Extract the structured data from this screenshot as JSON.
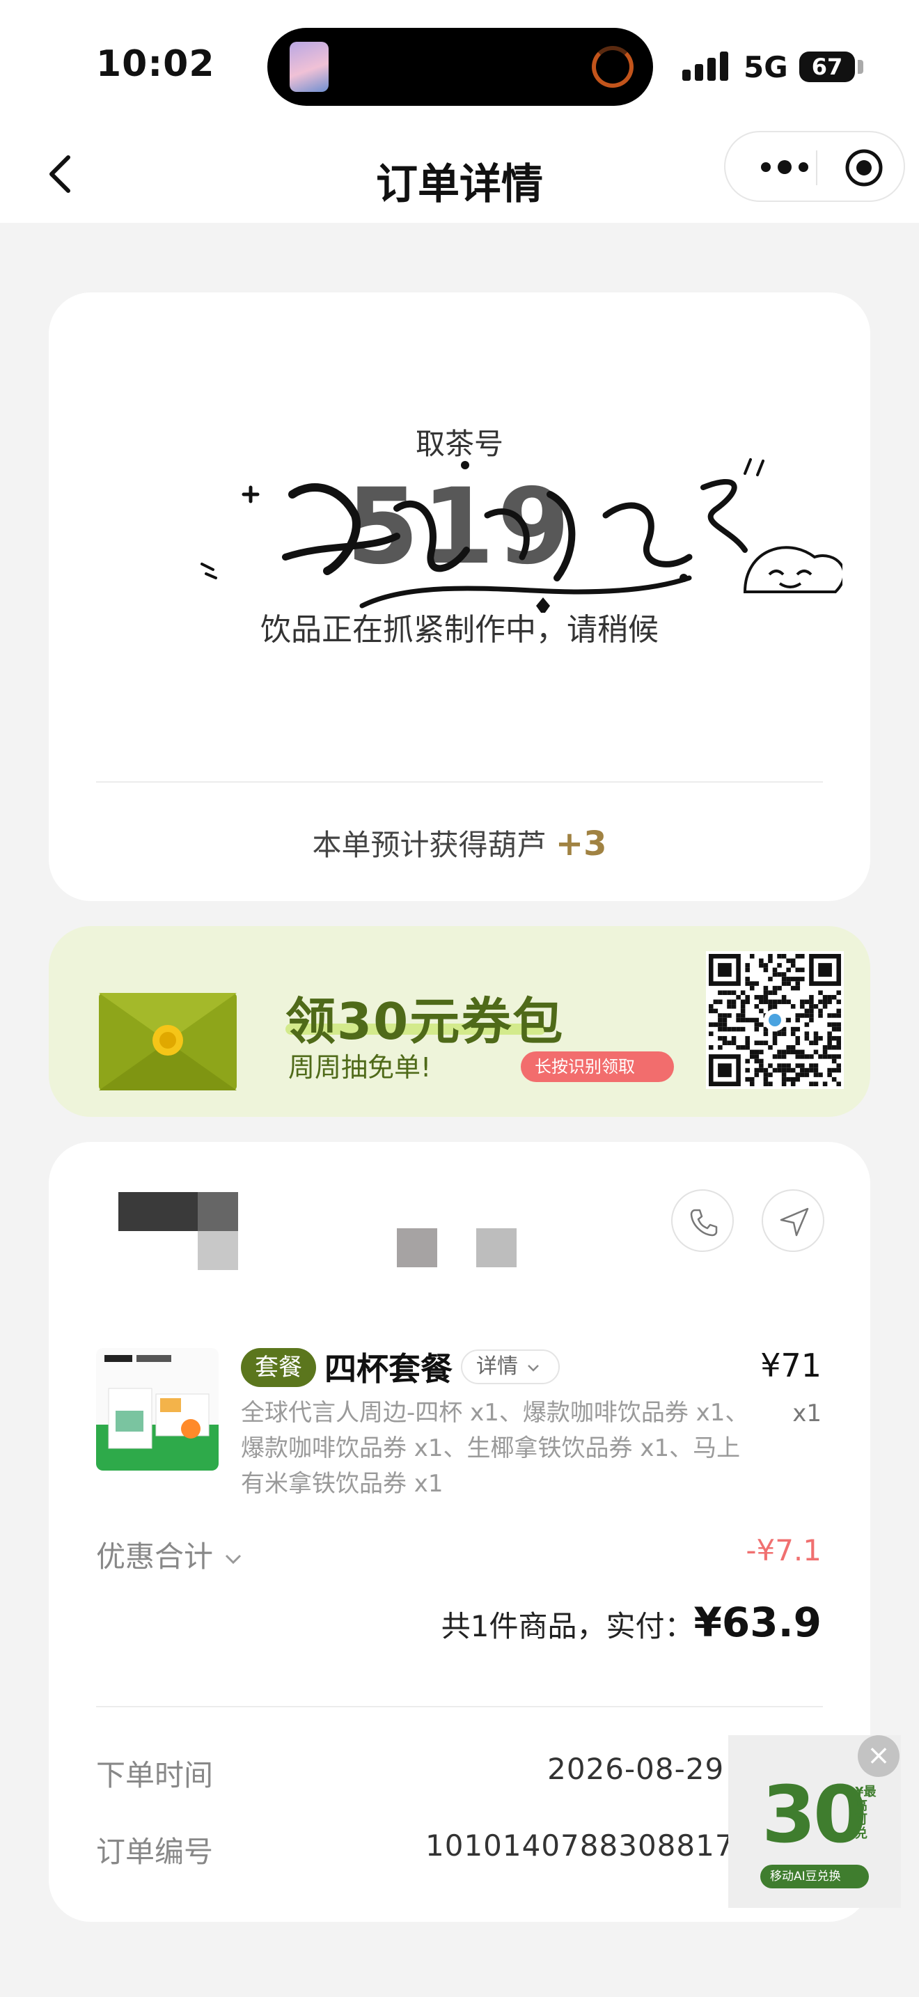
{
  "status_bar": {
    "time": "10:02",
    "network": "5G",
    "battery": "67"
  },
  "nav": {
    "title": "订单详情"
  },
  "pickup": {
    "label": "取茶号",
    "number": "519",
    "status_text": "饮品正在抓紧制作中，请稍候",
    "bonus_text": "本单预计获得葫芦",
    "bonus_value": "+3"
  },
  "banner": {
    "title": "领30元券包",
    "subtitle": "周周抽免单!",
    "pill": "长按识别领取"
  },
  "order_item": {
    "tag": "套餐",
    "name": "四杯套餐",
    "detail_label": "详情",
    "price": "¥71",
    "quantity": "x1",
    "description": "全球代言人周边-四杯 x1、爆款咖啡饮品券 x1、爆款咖啡饮品券 x1、生椰拿铁饮品券 x1、马上有米拿铁饮品券 x1"
  },
  "discount": {
    "label": "优惠合计",
    "value": "-¥7.1"
  },
  "summary": {
    "text": "共1件商品，实付：",
    "paid": "¥63.9"
  },
  "info": {
    "order_time_label": "下单时间",
    "order_time_value": "2026-08-29 10",
    "order_no_label": "订单编号",
    "order_no_value": "101014078830881726"
  },
  "float_ad": {
    "amount": "30",
    "side_text": "¥最高可兑",
    "pill": "移动AI豆兑换"
  },
  "colors": {
    "accent_green": "#5b761d",
    "discount_red": "#f07070",
    "gold": "#a08242",
    "banner_bg": "#eef4da"
  },
  "icons": [
    "back-icon",
    "more-icon",
    "target-close-icon",
    "phone-icon",
    "navigation-icon",
    "envelope-icon",
    "qr-code-icon",
    "chevron-down-icon",
    "close-icon"
  ]
}
